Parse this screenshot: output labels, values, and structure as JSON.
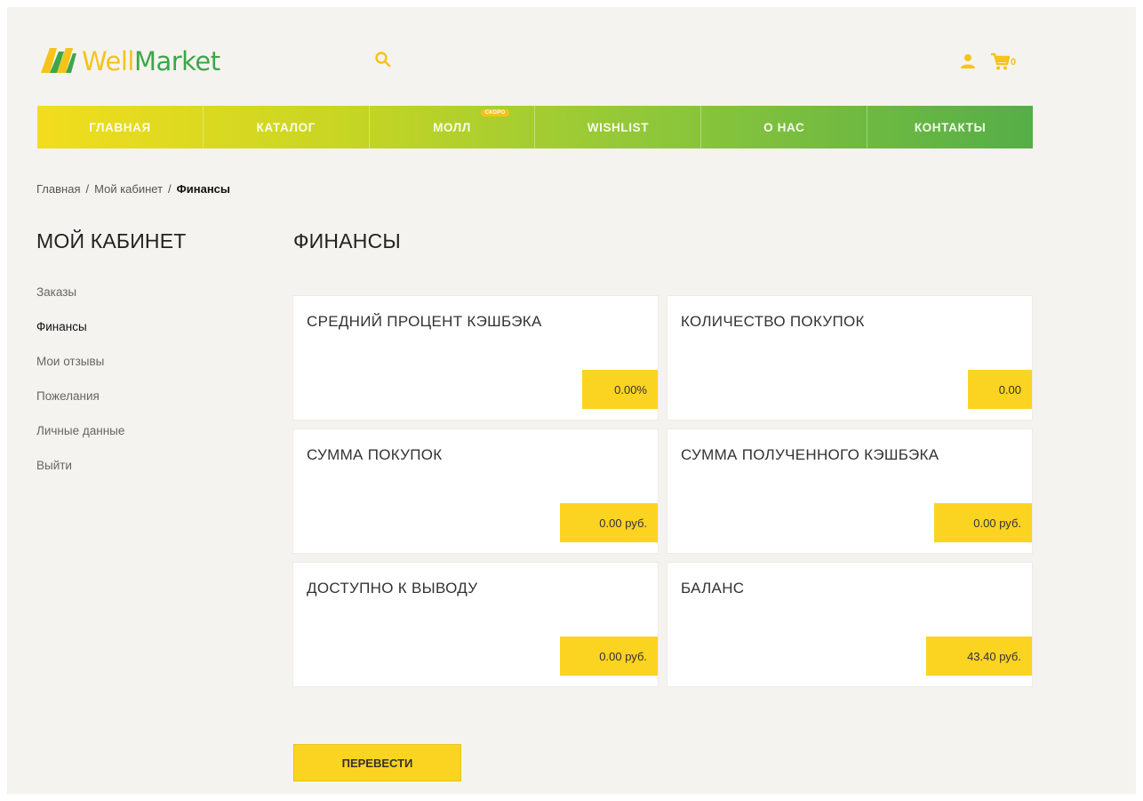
{
  "header": {
    "logo_well": "Well",
    "logo_market": "Market",
    "cart_count": "0"
  },
  "nav": {
    "items": [
      {
        "label": "ГЛАВНАЯ"
      },
      {
        "label": "КАТАЛОГ"
      },
      {
        "label": "МОЛЛ",
        "badge": "СКОРО"
      },
      {
        "label": "WISHLIST"
      },
      {
        "label": "О НАС"
      },
      {
        "label": "КОНТАКТЫ"
      }
    ]
  },
  "breadcrumb": {
    "items": [
      "Главная",
      "Мой кабинет",
      "Финансы"
    ],
    "separator": "/"
  },
  "sidebar": {
    "title": "МОЙ КАБИНЕТ",
    "items": [
      {
        "label": "Заказы"
      },
      {
        "label": "Финансы"
      },
      {
        "label": "Мои отзывы"
      },
      {
        "label": "Пожелания"
      },
      {
        "label": "Личные данные"
      },
      {
        "label": "Выйти"
      }
    ]
  },
  "main": {
    "title": "ФИНАНСЫ",
    "cards": [
      {
        "label": "СРЕДНИЙ ПРОЦЕНТ КЭШБЭКА",
        "value": "0.00%"
      },
      {
        "label": "КОЛИЧЕСТВО ПОКУПОК",
        "value": "0.00"
      },
      {
        "label": "СУММА ПОКУПОК",
        "value": "0.00 руб."
      },
      {
        "label": "СУММА ПОЛУЧЕННОГО КЭШБЭКА",
        "value": "0.00 руб."
      },
      {
        "label": "ДОСТУПНО К ВЫВОДУ",
        "value": "0.00 руб."
      },
      {
        "label": "БАЛАНС",
        "value": "43.40 руб."
      }
    ],
    "transfer_button": "ПЕРЕВЕСТИ"
  },
  "colors": {
    "accent_yellow": "#fbd321",
    "brand_green": "#3da64a",
    "brand_yellow": "#f5c31a",
    "page_background": "#f4f3ef"
  },
  "icons": [
    "logo-mark-icon",
    "search-icon",
    "user-icon",
    "cart-icon"
  ]
}
